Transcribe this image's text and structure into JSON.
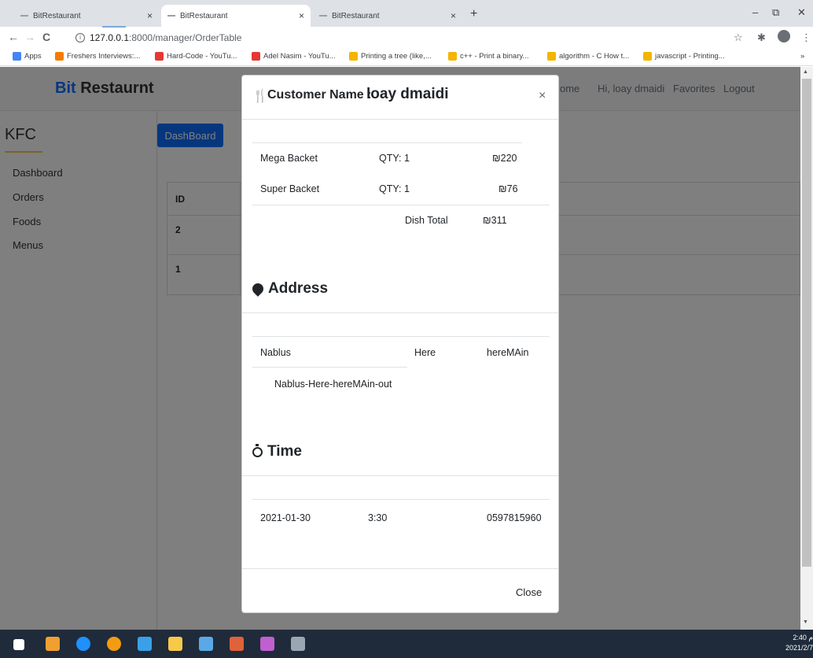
{
  "browser": {
    "tabs": [
      {
        "title": "BitRestaurant",
        "close": "×"
      },
      {
        "title": "BitRestaurant",
        "close": "×"
      },
      {
        "title": "BitRestaurant",
        "close": "×"
      }
    ],
    "new_tab": "+",
    "window_controls": {
      "minimize": "–",
      "restore": "⧉",
      "close": "✕"
    },
    "nav": {
      "back": "←",
      "forward": "→",
      "reload": "C"
    },
    "url_host": "127.0.0.1",
    "url_path": ":8000/manager/OrderTable",
    "star": "☆",
    "puzzle": "✱",
    "menu": "⋮",
    "bookmarks": [
      {
        "label": "Apps",
        "color": "#4285f4"
      },
      {
        "label": "Freshers Interviews:...",
        "color": "#f57c00"
      },
      {
        "label": "Hard-Code - YouTu...",
        "color": "#e53935"
      },
      {
        "label": "Adel Nasim - YouTu...",
        "color": "#e53935"
      },
      {
        "label": "Printing a tree (like,...",
        "color": "#f4b400"
      },
      {
        "label": "c++ - Print a binary...",
        "color": "#f4b400"
      },
      {
        "label": "algorithm - C How t...",
        "color": "#f4b400"
      },
      {
        "label": "javascript - Printing...",
        "color": "#f4b400"
      }
    ],
    "bookmarks_more": "»"
  },
  "site": {
    "brand_bit": "Bit",
    "brand_rest": " Restaurnt",
    "nav_home": "ome",
    "nav_greeting": "Hi, loay dmaidi",
    "nav_favorites": "Favorites",
    "nav_logout": "Logout",
    "sidebar_title": "KFC",
    "sidebar_items": [
      "Dashboard",
      "Orders",
      "Foods",
      "Menus"
    ],
    "dashboard_button": "DashBoard",
    "table": {
      "header": "ID",
      "rows": [
        "2",
        "1"
      ]
    }
  },
  "modal": {
    "header_icon": "🍴",
    "header_label": "Customer Name :",
    "customer_name": "loay dmaidi",
    "close_x": "×",
    "items": [
      {
        "name": "Mega Backet",
        "qty": "QTY: 1",
        "price": "₪220"
      },
      {
        "name": "Super Backet",
        "qty": "QTY: 1",
        "price": "₪76"
      }
    ],
    "dish_total_label": "Dish Total",
    "dish_total_value": "₪311",
    "address_title": "Address",
    "address": {
      "city": "Nablus",
      "street": "Here",
      "building": "hereMAin",
      "full": "Nablus-Here-hereMAin-out"
    },
    "time_title": "Time",
    "time": {
      "date": "2021-01-30",
      "hour": "3:30",
      "phone": "0597815960"
    },
    "footer_close": "Close"
  },
  "taskbar": {
    "time": "2:40 م",
    "date": "2021/2/7",
    "icon_colors": [
      "#ffffff",
      "#f0a030",
      "#1e90ff",
      "#f39c12",
      "#3aa0e8",
      "#f7c948",
      "#5aa9e6",
      "#e0623a",
      "#c060d0",
      "#9aa6b2"
    ]
  }
}
